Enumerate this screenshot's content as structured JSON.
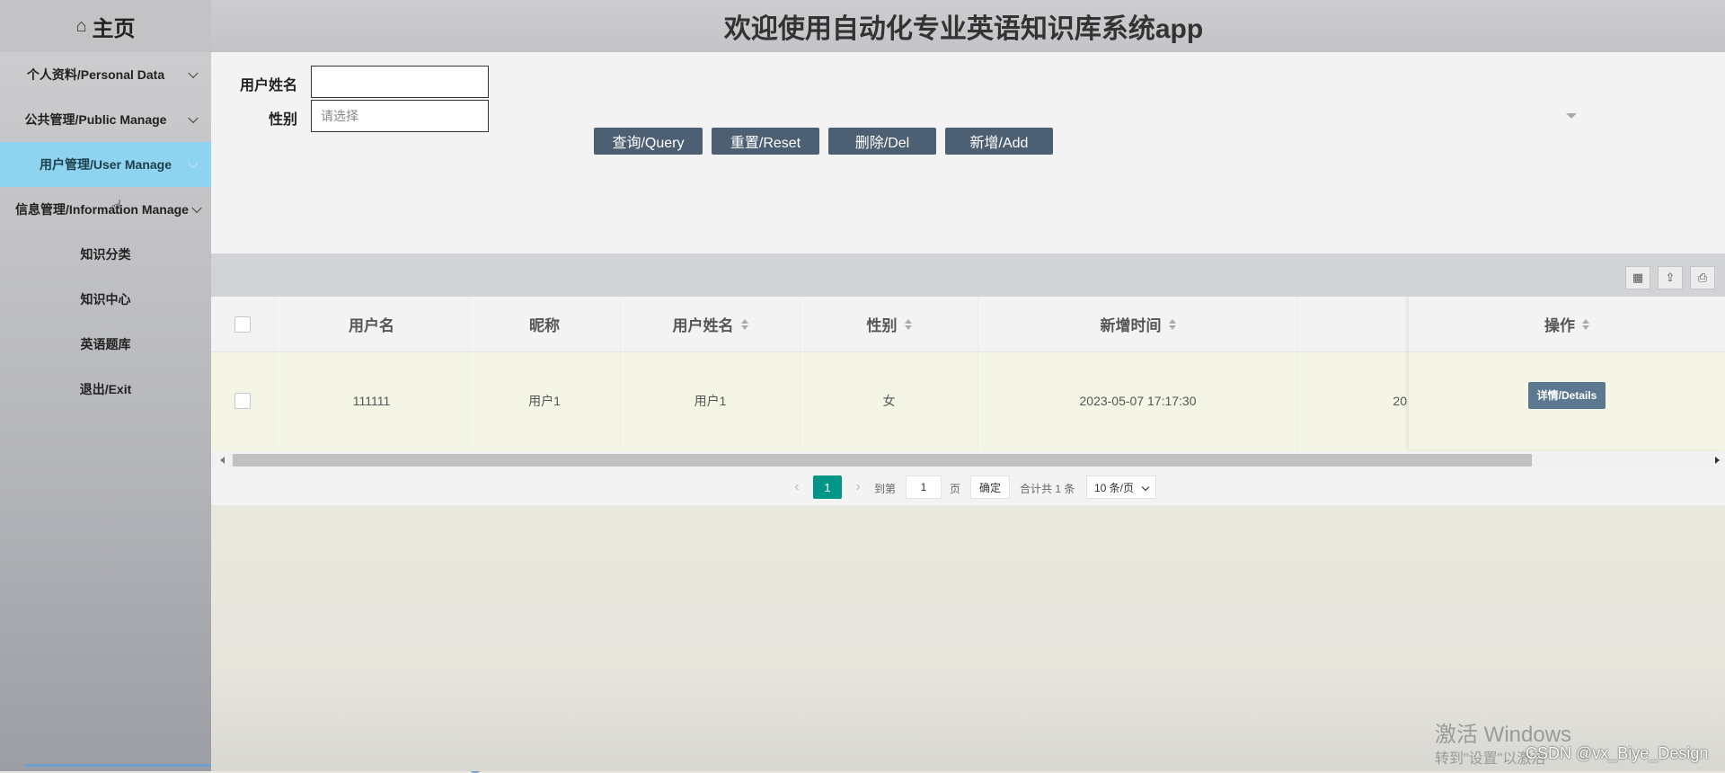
{
  "sidebar": {
    "home_label": "主页",
    "items": [
      {
        "label": "个人资料/Personal Data",
        "active": false
      },
      {
        "label": "公共管理/Public Manage",
        "active": false
      },
      {
        "label": "用户管理/User Manage",
        "active": true
      },
      {
        "label": "信息管理/Information Manage",
        "active": false
      }
    ],
    "sub_items": [
      "知识分类",
      "知识中心",
      "英语题库",
      "退出/Exit"
    ]
  },
  "header": {
    "title": "欢迎使用自动化专业英语知识库系统app"
  },
  "search": {
    "username_label": "用户姓名",
    "username_value": "",
    "gender_label": "性别",
    "gender_placeholder": "请选择",
    "buttons": {
      "query": "查询/Query",
      "reset": "重置/Reset",
      "delete": "删除/Del",
      "add": "新增/Add"
    }
  },
  "table": {
    "columns": [
      "用户名",
      "昵称",
      "用户姓名",
      "性别",
      "新增时间",
      "操作"
    ],
    "rows": [
      {
        "username": "111111",
        "nickname": "用户1",
        "realname": "用户1",
        "gender": "女",
        "created": "2023-05-07 17:17:30",
        "partial": "20",
        "action": "详情/Details"
      }
    ]
  },
  "pager": {
    "current": "1",
    "goto_label": "到第",
    "goto_value": "1",
    "page_label": "页",
    "confirm": "确定",
    "total": "合计共 1 条",
    "per_page": "10 条/页"
  },
  "overlay": {
    "activate_line1": "激活 Windows",
    "activate_line2": "转到\"设置\"以激活",
    "watermark": "CSDN @vx_Biye_Design"
  },
  "colors": {
    "accent": "#8ed3ef",
    "button": "#4d5f72",
    "page_active": "#009688"
  }
}
